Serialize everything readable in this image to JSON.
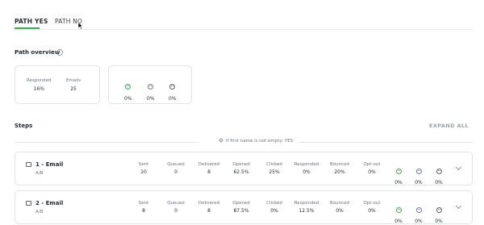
{
  "tabs": {
    "yes_label": "PATH YES",
    "no_label": "PATH NO"
  },
  "overview": {
    "title": "Path overview",
    "info_icon": "i",
    "responded_label": "Responded",
    "responded_value": "16%",
    "emails_label": "Emails",
    "emails_value": "25",
    "sentiment": [
      {
        "icon": "happy-face-icon",
        "value": "0%"
      },
      {
        "icon": "neutral-face-icon",
        "value": "0%"
      },
      {
        "icon": "sad-face-icon",
        "value": "0%"
      }
    ]
  },
  "steps": {
    "title": "Steps",
    "expand_all": "EXPAND ALL",
    "condition": "If first name is not empty: YES",
    "metric_labels": [
      "Sent",
      "Queued",
      "Delivered",
      "Opened",
      "Clicked",
      "Responded",
      "Bounced",
      "Opt-out"
    ],
    "items": [
      {
        "name": "1 - Email",
        "sub": "A/B",
        "metrics": [
          "10",
          "0",
          "8",
          "62.5%",
          "25%",
          "0%",
          "20%",
          "0%"
        ],
        "sentiment": [
          "0%",
          "0%",
          "0%"
        ]
      },
      {
        "name": "2 - Email",
        "sub": "A/B",
        "metrics": [
          "8",
          "0",
          "8",
          "87.5%",
          "0%",
          "12.5%",
          "0%",
          "0%"
        ],
        "sentiment": [
          "0%",
          "0%",
          "0%"
        ]
      }
    ]
  },
  "colors": {
    "accent": "#2fb24f",
    "happy": "#37b55a",
    "neutral": "#6f7dad",
    "sad": "#5b6168"
  }
}
